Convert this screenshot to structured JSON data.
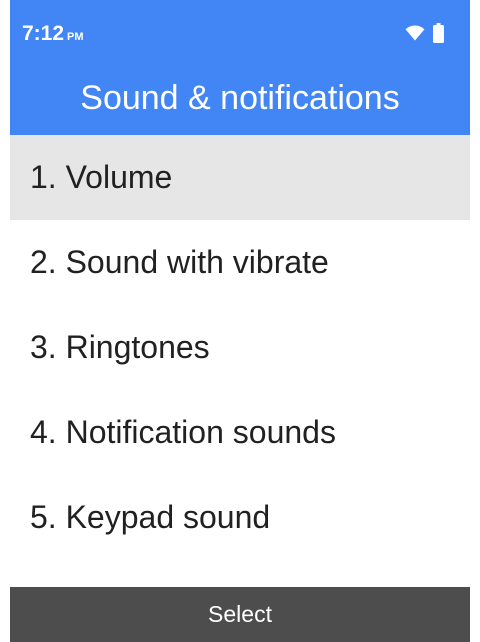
{
  "status_bar": {
    "time": "7:12",
    "ampm": "PM",
    "icons": [
      "wifi-icon",
      "battery-icon"
    ]
  },
  "header": {
    "title": "Sound & notifications",
    "background_color": "#4285f4"
  },
  "menu": {
    "selected_index": 0,
    "selected_color": "#e6e6e6",
    "items": [
      {
        "label": "1. Volume"
      },
      {
        "label": "2. Sound with vibrate"
      },
      {
        "label": "3. Ringtones"
      },
      {
        "label": "4. Notification sounds"
      },
      {
        "label": "5. Keypad sound"
      }
    ]
  },
  "softkeys": {
    "center_label": "Select",
    "background_color": "#4d4d4d"
  }
}
